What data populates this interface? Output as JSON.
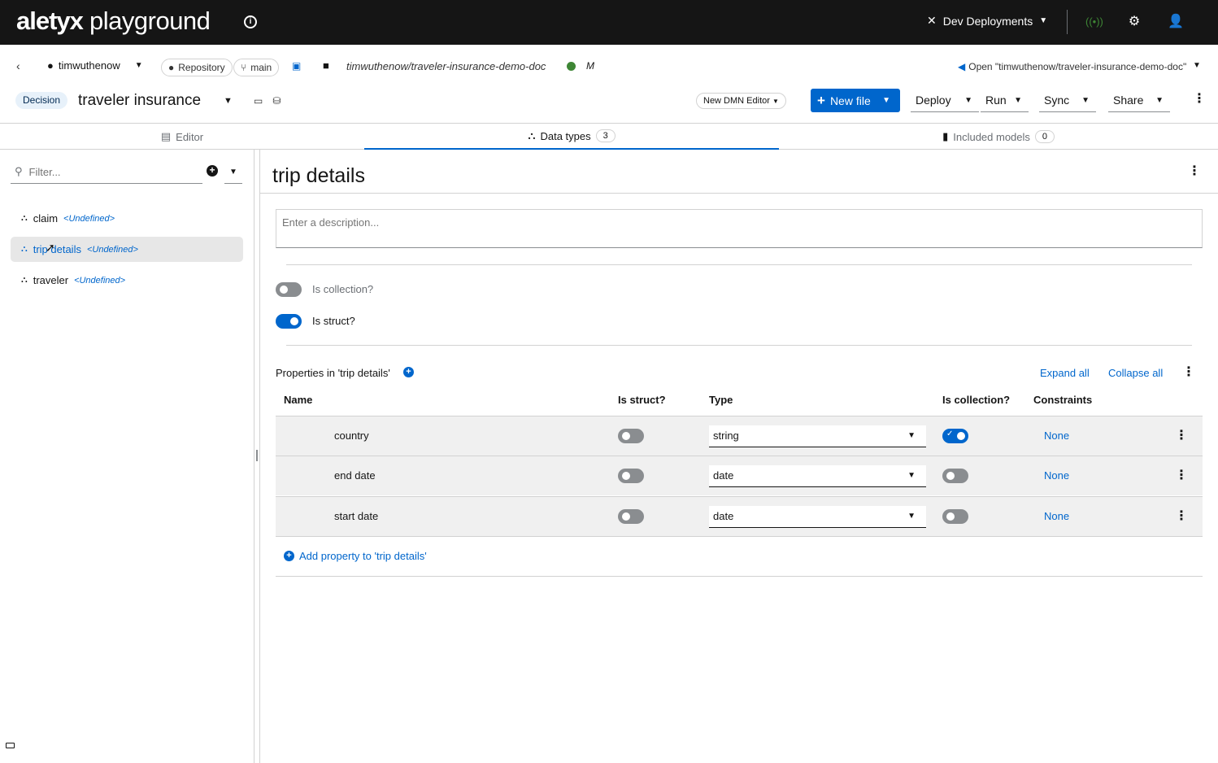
{
  "masthead": {
    "logo_bold": "aletyx",
    "logo_rest": " playground",
    "deployments_label": "Dev Deployments"
  },
  "repo": {
    "owner": "timwuthenow",
    "repository_label": "Repository",
    "branch": "main",
    "path": "timwuthenow/traveler-insurance-demo-doc",
    "modified_flag": "M",
    "open_vscode": "Open \"timwuthenow/traveler-insurance-demo-doc\""
  },
  "toolbar": {
    "badge": "Decision",
    "file_title": "traveler insurance",
    "editor_switch": "New DMN Editor",
    "new_file": "New file",
    "deploy": "Deploy",
    "run": "Run",
    "sync": "Sync",
    "share": "Share"
  },
  "tabs": [
    {
      "label": "Editor",
      "count": null
    },
    {
      "label": "Data types",
      "count": "3"
    },
    {
      "label": "Included models",
      "count": "0"
    }
  ],
  "sidebar": {
    "filter_placeholder": "Filter...",
    "items": [
      {
        "name": "claim",
        "type": "<Undefined>"
      },
      {
        "name": "trip details",
        "type": "<Undefined>"
      },
      {
        "name": "traveler",
        "type": "<Undefined>"
      }
    ]
  },
  "main": {
    "title": "trip details",
    "description_placeholder": "Enter a description...",
    "is_collection_label": "Is collection?",
    "is_struct_label": "Is struct?",
    "properties_title": "Properties in 'trip details'",
    "expand_all": "Expand all",
    "collapse_all": "Collapse all",
    "columns": {
      "name": "Name",
      "is_struct": "Is struct?",
      "type": "Type",
      "is_collection": "Is collection?",
      "constraints": "Constraints"
    },
    "rows": [
      {
        "name": "country",
        "type": "string",
        "constraints": "None"
      },
      {
        "name": "end date",
        "type": "date",
        "constraints": "None"
      },
      {
        "name": "start date",
        "type": "date",
        "constraints": "None"
      }
    ],
    "add_property": "Add property to 'trip details'"
  },
  "colors": {
    "accent": "#0066cc",
    "masthead": "#151515"
  }
}
